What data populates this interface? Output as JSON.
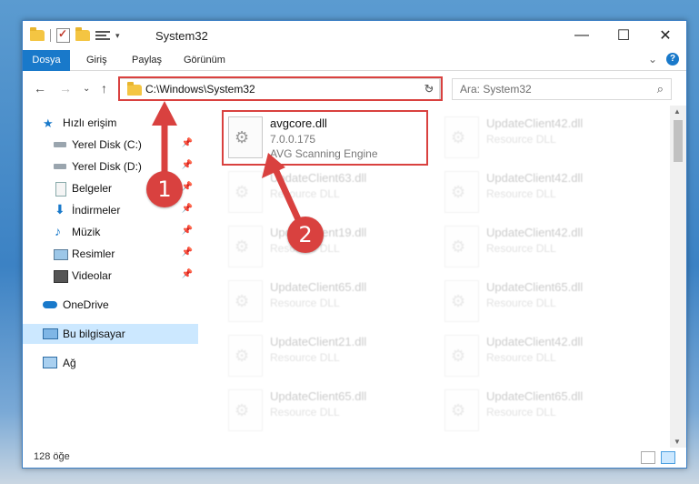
{
  "window": {
    "title": "System32",
    "controls": {
      "minimize": "—",
      "maximize": "☐",
      "close": "✕"
    }
  },
  "ribbon": {
    "tabs": [
      "Dosya",
      "Giriş",
      "Paylaş",
      "Görünüm"
    ],
    "expand_icon": "⌄",
    "help": "?"
  },
  "nav": {
    "back": "←",
    "forward": "→",
    "recent": "⌄",
    "up": "↑",
    "address": "C:\\Windows\\System32",
    "address_dropdown": "⌄",
    "refresh": "↻",
    "search_placeholder": "Ara: System32",
    "search_icon": "⌕"
  },
  "sidebar": {
    "items": [
      {
        "label": "Hızlı erişim",
        "icon": "star-icon"
      },
      {
        "label": "Yerel Disk (C:)",
        "icon": "drive-icon",
        "pinned": true
      },
      {
        "label": "Yerel Disk (D:)",
        "icon": "drive-icon",
        "pinned": true
      },
      {
        "label": "Belgeler",
        "icon": "documents-icon",
        "pinned": true
      },
      {
        "label": "İndirmeler",
        "icon": "download-icon",
        "pinned": true
      },
      {
        "label": "Müzik",
        "icon": "music-icon",
        "pinned": true
      },
      {
        "label": "Resimler",
        "icon": "pictures-icon",
        "pinned": true
      },
      {
        "label": "Videolar",
        "icon": "video-icon",
        "pinned": true
      },
      {
        "label": "OneDrive",
        "icon": "cloud-icon"
      },
      {
        "label": "Bu bilgisayar",
        "icon": "computer-icon",
        "selected": true
      },
      {
        "label": "Ağ",
        "icon": "network-icon"
      }
    ],
    "pin_glyph": "📌"
  },
  "files": [
    {
      "name": "avgcore.dll",
      "line2": "7.0.0.175",
      "line3": "AVG Scanning Engine"
    },
    {
      "name": "UpdateClient42.dll",
      "line2": "Resource DLL"
    },
    {
      "name": "UpdateClient63.dll",
      "line2": "Resource DLL"
    },
    {
      "name": "UpdateClient42.dll",
      "line2": "Resource DLL"
    },
    {
      "name": "UpdateClient19.dll",
      "line2": "Resource DLL"
    },
    {
      "name": "UpdateClient42.dll",
      "line2": "Resource DLL"
    },
    {
      "name": "UpdateClient65.dll",
      "line2": "Resource DLL"
    },
    {
      "name": "UpdateClient65.dll",
      "line2": "Resource DLL"
    },
    {
      "name": "UpdateClient21.dll",
      "line2": "Resource DLL"
    },
    {
      "name": "UpdateClient42.dll",
      "line2": "Resource DLL"
    },
    {
      "name": "UpdateClient65.dll",
      "line2": "Resource DLL"
    },
    {
      "name": "UpdateClient65.dll",
      "line2": "Resource DLL"
    }
  ],
  "status": {
    "item_count": "128 öğe"
  },
  "annotations": {
    "badge1": "1",
    "badge2": "2",
    "color": "#d9413f"
  }
}
